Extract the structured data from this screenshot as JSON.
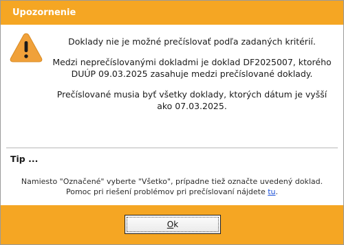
{
  "window": {
    "title": "Upozornenie"
  },
  "icon": "warning-triangle-icon",
  "colors": {
    "accent": "#f5a623",
    "icon_fill": "#f0a13a",
    "link": "#1a4fd8"
  },
  "message": {
    "line1": "Doklady nie je možné prečíslovať podľa zadaných kritérií.",
    "line2": "Medzi neprečíslovanými dokladmi je doklad DF2025007, ktorého\nDUÚP 09.03.2025 zasahuje medzi prečíslované doklady.",
    "line3": "Prečíslované musia byť všetky doklady, ktorých dátum je vyšší\nako 07.03.2025."
  },
  "tip": {
    "heading": "Tip ...",
    "line1": "Namiesto \"Označené\" vyberte \"Všetko\", prípadne tiež označte uvedený doklad.",
    "line2_prefix": "Pomoc pri riešení problémov pri prečíslovaní nájdete ",
    "link_text": "tu",
    "line2_suffix": "."
  },
  "buttons": {
    "ok_underlined": "O",
    "ok_rest": "k"
  }
}
